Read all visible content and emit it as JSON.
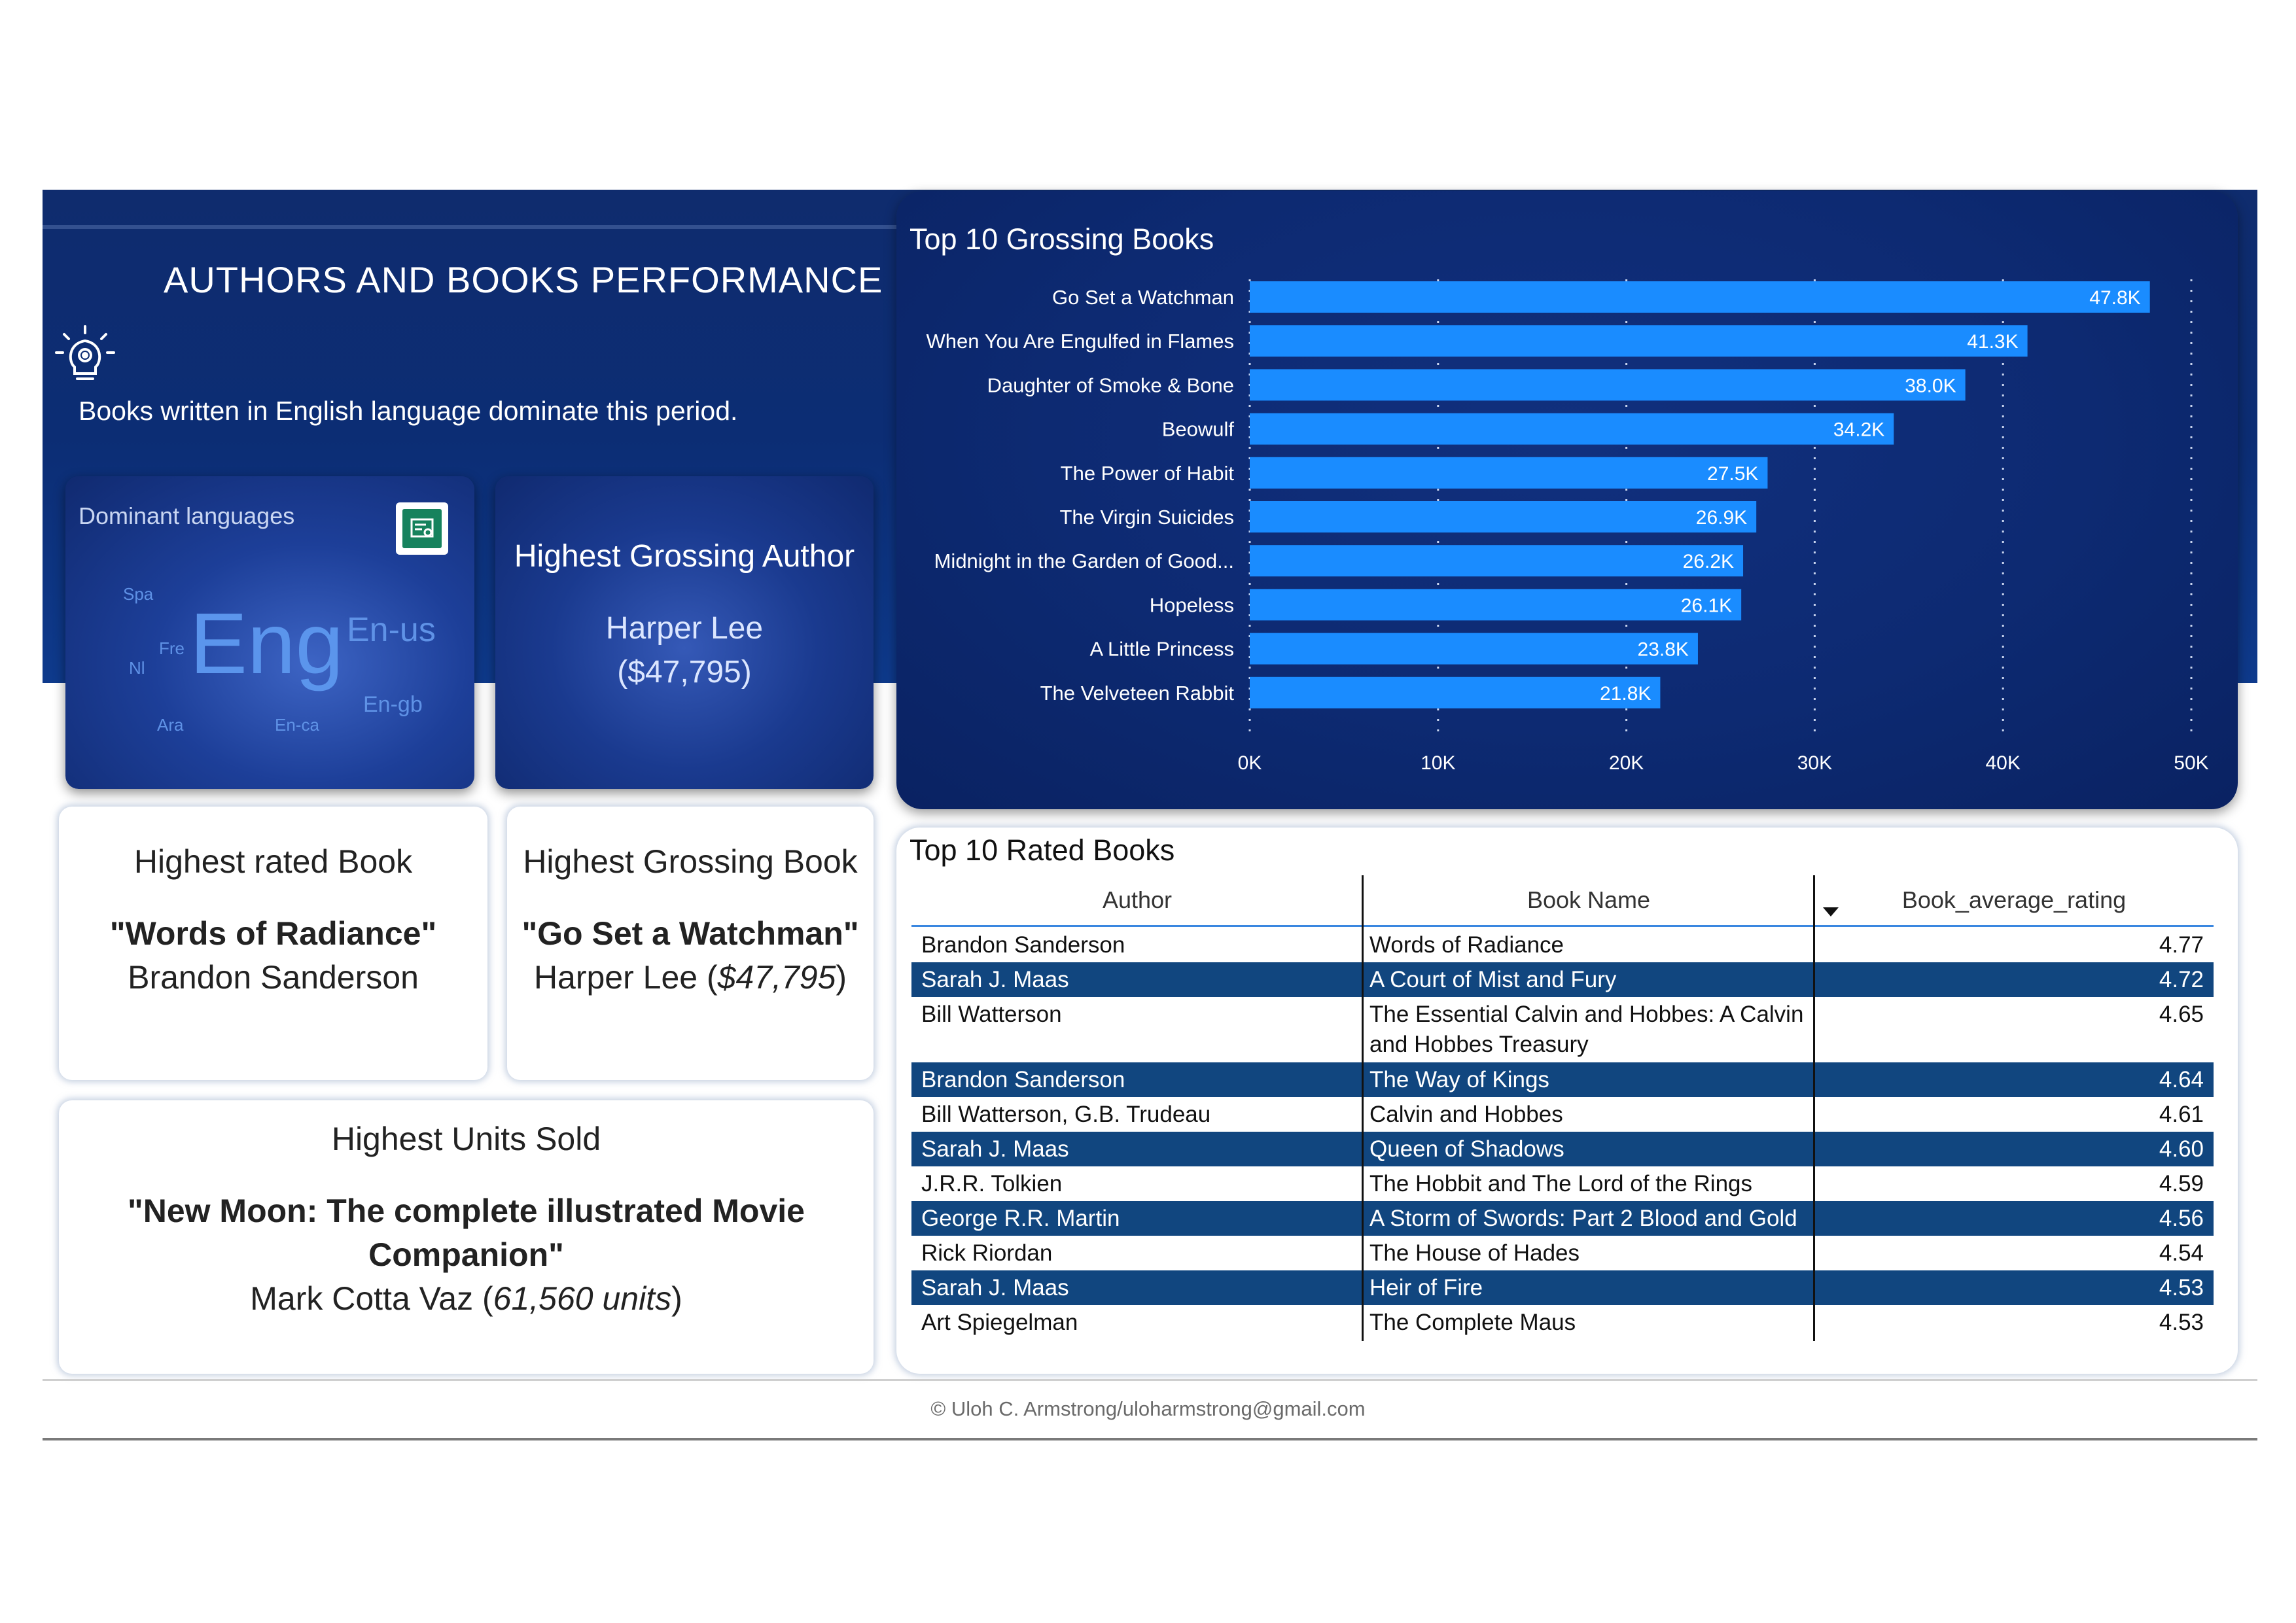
{
  "header": {
    "title": "AUTHORS AND BOOKS PERFORMANCE",
    "insight": "Books written in English language dominate this period."
  },
  "languages": {
    "title": "Dominant languages",
    "words": [
      "Spa",
      "Fre",
      "Nl",
      "Eng",
      "En-us",
      "En-gb",
      "Ara",
      "En-ca"
    ],
    "icon": "certificate-icon",
    "icon_color": "#16825d"
  },
  "author_card": {
    "title": "Highest Grossing Author",
    "name": "Harper Lee",
    "value": "($47,795)"
  },
  "rated_card": {
    "title": "Highest rated Book",
    "book": "\"Words of Radiance\"",
    "author": "Brandon Sanderson"
  },
  "grossing_book_card": {
    "title": "Highest Grossing Book",
    "book": "\"Go Set a Watchman\"",
    "author": "Harper Lee (",
    "value": "$47,795",
    "close": ")"
  },
  "units_card": {
    "title": "Highest Units Sold",
    "book_line1": "\"New Moon: The complete illustrated Movie",
    "book_line2": "Companion\"",
    "author": "Mark Cotta Vaz (",
    "value": "61,560 units",
    "close": ")"
  },
  "chart_data": {
    "type": "bar",
    "orientation": "horizontal",
    "title": "Top 10 Grossing Books",
    "categories": [
      "Go Set a Watchman",
      "When You Are Engulfed in Flames",
      "Daughter of Smoke & Bone",
      "Beowulf",
      "The Power of Habit",
      "The Virgin Suicides",
      "Midnight in the Garden of Good...",
      "Hopeless",
      "A Little Princess",
      "The Velveteen Rabbit"
    ],
    "values": [
      47800,
      41300,
      38000,
      34200,
      27500,
      26900,
      26200,
      26100,
      23800,
      21800
    ],
    "data_labels": [
      "47.8K",
      "41.3K",
      "38.0K",
      "34.2K",
      "27.5K",
      "26.9K",
      "26.2K",
      "26.1K",
      "23.8K",
      "21.8K"
    ],
    "x_ticks": [
      "0K",
      "10K",
      "20K",
      "30K",
      "40K",
      "50K"
    ],
    "xlim": [
      0,
      50000
    ],
    "xlabel": "",
    "ylabel": "",
    "grid": true,
    "bar_color": "#1a8cff",
    "label_color": "#ffffff"
  },
  "table": {
    "title": "Top 10 Rated Books",
    "columns": [
      "Author",
      "Book Name",
      "Book_average_rating"
    ],
    "rows": [
      {
        "author": "Brandon Sanderson",
        "book": "Words of Radiance",
        "rating": "4.77"
      },
      {
        "author": "Sarah J. Maas",
        "book": "A Court of Mist and Fury",
        "rating": "4.72"
      },
      {
        "author": "Bill Watterson",
        "book": "The Essential Calvin and Hobbes: A Calvin and Hobbes Treasury",
        "rating": "4.65"
      },
      {
        "author": "Brandon Sanderson",
        "book": "The Way of Kings",
        "rating": "4.64"
      },
      {
        "author": "Bill Watterson, G.B. Trudeau",
        "book": "Calvin and Hobbes",
        "rating": "4.61"
      },
      {
        "author": "Sarah J. Maas",
        "book": "Queen of Shadows",
        "rating": "4.60"
      },
      {
        "author": "J.R.R. Tolkien",
        "book": "The Hobbit and The Lord of the Rings",
        "rating": "4.59"
      },
      {
        "author": "George R.R. Martin",
        "book": "A Storm of Swords: Part 2 Blood and Gold",
        "rating": "4.56"
      },
      {
        "author": "Rick Riordan",
        "book": "The House of Hades",
        "rating": "4.54"
      },
      {
        "author": "Sarah J. Maas",
        "book": "Heir of Fire",
        "rating": "4.53"
      },
      {
        "author": "Art Spiegelman",
        "book": "The Complete Maus",
        "rating": "4.53"
      }
    ],
    "alt_row_color": "#11467f"
  },
  "footer": "© Uloh C. Armstrong/uloharmstrong@gmail.com"
}
